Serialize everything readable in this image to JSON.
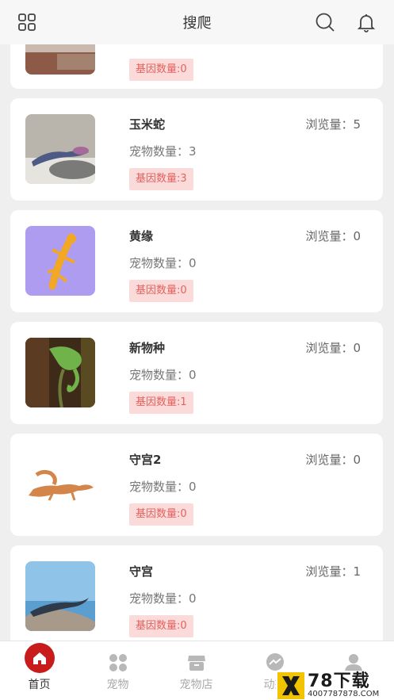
{
  "header": {
    "title": "搜爬",
    "left_icon": "grid-icon",
    "right_icons": [
      "search-icon",
      "bell-icon"
    ]
  },
  "labels": {
    "views_prefix": "浏览量：",
    "count_prefix": "宠物数量：",
    "gene_prefix": "基因数量:"
  },
  "species": [
    {
      "name": "",
      "views": "",
      "pet_count": "",
      "gene": "基因数量:0"
    },
    {
      "name": "玉米蛇",
      "views": "浏览量：5",
      "pet_count": "宠物数量：3",
      "gene": "基因数量:3"
    },
    {
      "name": "黄缘",
      "views": "浏览量：0",
      "pet_count": "宠物数量：0",
      "gene": "基因数量:0"
    },
    {
      "name": "新物种",
      "views": "浏览量：0",
      "pet_count": "宠物数量：0",
      "gene": "基因数量:1"
    },
    {
      "name": "守宫2",
      "views": "浏览量：0",
      "pet_count": "宠物数量：0",
      "gene": "基因数量:0"
    },
    {
      "name": "守宫",
      "views": "浏览量：1",
      "pet_count": "宠物数量：0",
      "gene": "基因数量:0"
    }
  ],
  "tabbar": {
    "tabs": [
      {
        "label": "首页",
        "icon": "home-icon",
        "active": true
      },
      {
        "label": "宠物",
        "icon": "pet-icon",
        "active": false
      },
      {
        "label": "宠物店",
        "icon": "store-icon",
        "active": false
      },
      {
        "label": "动态",
        "icon": "moments-icon",
        "active": false
      },
      {
        "label": "",
        "icon": "profile-icon",
        "active": false
      }
    ]
  },
  "watermark": {
    "big": "78下载",
    "small": "4007787878.COM"
  },
  "colors": {
    "accent": "#c81b1b",
    "gene_bg": "#fbdada",
    "gene_text": "#e2625f"
  }
}
